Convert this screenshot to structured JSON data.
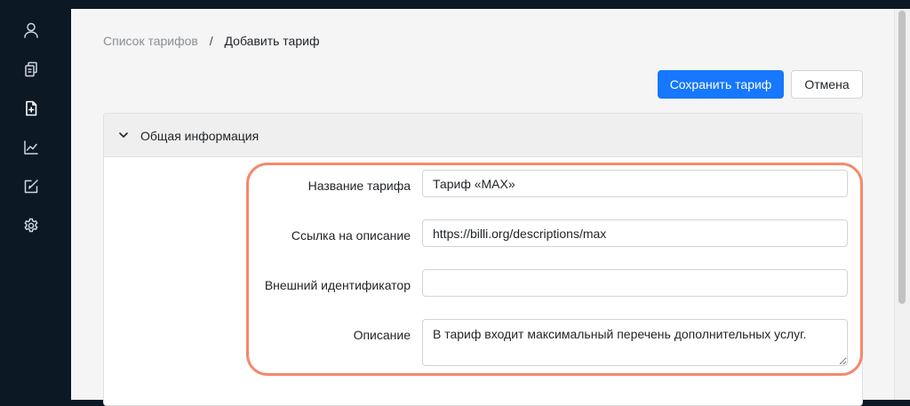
{
  "sidebar": {
    "items": [
      {
        "icon": "user-icon"
      },
      {
        "icon": "documents-icon"
      },
      {
        "icon": "document-add-icon"
      },
      {
        "icon": "chart-icon"
      },
      {
        "icon": "edit-square-icon"
      },
      {
        "icon": "gear-icon"
      }
    ]
  },
  "breadcrumb": {
    "parent": "Список тарифов",
    "separator": "/",
    "current": "Добавить тариф"
  },
  "toolbar": {
    "save_label": "Сохранить тариф",
    "cancel_label": "Отмена"
  },
  "panel": {
    "title": "Общая информация",
    "expanded": true
  },
  "form": {
    "name_label": "Название тарифа",
    "name_value": "Тариф «MAX»",
    "link_label": "Ссылка на описание",
    "link_value": "https://billi.org/descriptions/max",
    "external_id_label": "Внешний идентификатор",
    "external_id_value": "",
    "description_label": "Описание",
    "description_value": "В тариф входит максимальный перечень дополнительных услуг."
  },
  "colors": {
    "primary": "#1677ff",
    "sidebar": "#0c1824",
    "highlight": "#f4896b"
  }
}
